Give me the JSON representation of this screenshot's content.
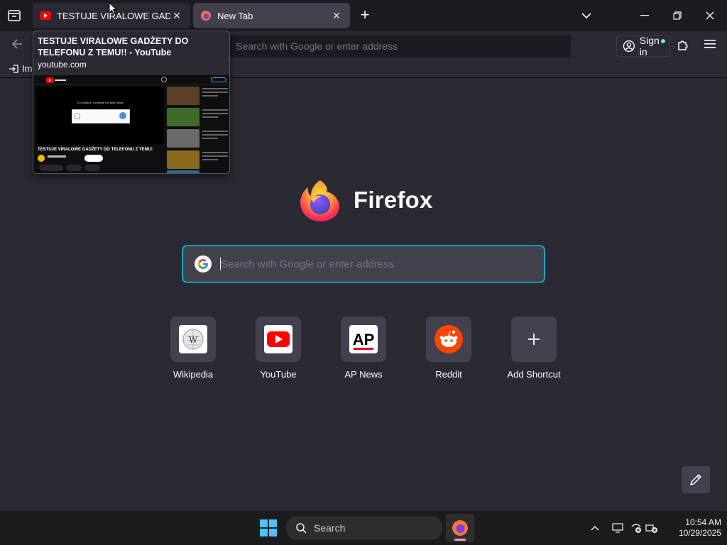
{
  "tabs": [
    {
      "label": "TESTUJE VIRALOWE GADŻETY DO TELEFONU Z TEMU!! - YouTube",
      "active": false
    },
    {
      "label": "New Tab",
      "active": true
    }
  ],
  "tab_preview": {
    "title": "TESTUJE VIRALOWE GADŻETY DO TELEFONU Z TEMU!! - YouTube",
    "url": "youtube.com",
    "thumb_message": "To continue, complete the task below",
    "thumb_video_title": "TESTUJE VIRALOWE GADŻETY DO TELEFONU Z TEMU!"
  },
  "navbar": {
    "url_placeholder": "Search with Google or enter address",
    "signin_label": "Sign in"
  },
  "bookmarks": {
    "import_label": "Im"
  },
  "newtab": {
    "brand": "Firefox",
    "search_placeholder": "Search with Google or enter address",
    "shortcuts": [
      {
        "label": "Wikipedia",
        "icon": "wikipedia-icon"
      },
      {
        "label": "YouTube",
        "icon": "youtube-icon"
      },
      {
        "label": "AP News",
        "icon": "ap-news-icon"
      },
      {
        "label": "Reddit",
        "icon": "reddit-icon"
      },
      {
        "label": "Add Shortcut",
        "icon": "plus-icon"
      }
    ]
  },
  "taskbar": {
    "search_label": "Search",
    "time": "10:54 AM",
    "date": "10/29/2025"
  },
  "colors": {
    "accent": "#00ddff",
    "windows_blue": "#4cc2ff",
    "youtube_red": "#ff0000",
    "reddit_orange": "#ff4500"
  }
}
